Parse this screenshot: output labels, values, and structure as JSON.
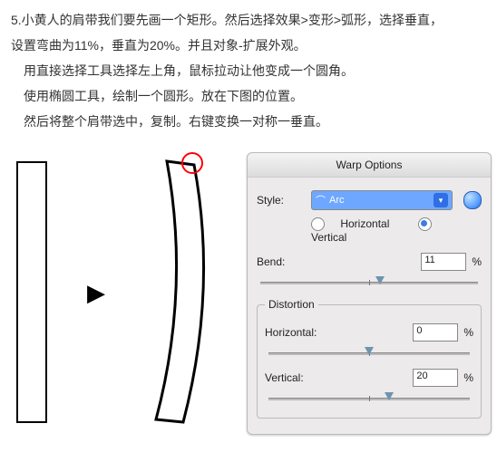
{
  "instructions": {
    "line1": "5.小黄人的肩带我们要先画一个矩形。然后选择效果>变形>弧形，选择垂直，",
    "line2": "设置弯曲为11%，垂直为20%。并且对象-扩展外观。",
    "line3": "用直接选择工具选择左上角，鼠标拉动让他变成一个圆角。",
    "line4": "使用椭圆工具，绘制一个圆形。放在下图的位置。",
    "line5": "然后将整个肩带选中，复制。右键变换一对称一垂直。"
  },
  "panel": {
    "title": "Warp Options",
    "style_label": "Style:",
    "style_value": "Arc",
    "horizontal_label": "Horizontal",
    "vertical_label": "Vertical",
    "bend_label": "Bend:",
    "bend_value": "11",
    "distortion_legend": "Distortion",
    "dist_h_label": "Horizontal:",
    "dist_h_value": "0",
    "dist_v_label": "Vertical:",
    "dist_v_value": "20",
    "percent": "%"
  }
}
